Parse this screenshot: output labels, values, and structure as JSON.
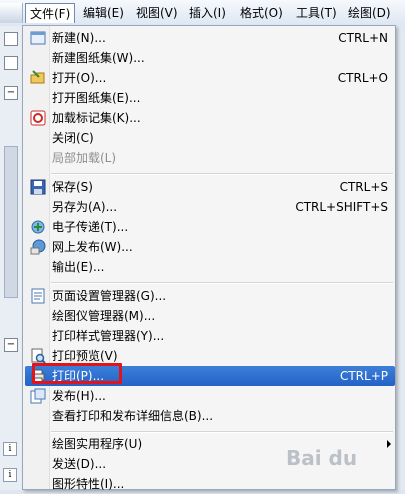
{
  "menubar": {
    "items": [
      "文件(F)",
      "编辑(E)",
      "视图(V)",
      "插入(I)",
      "格式(O)",
      "工具(T)",
      "绘图(D)"
    ],
    "active_index": 0
  },
  "file_menu": {
    "items": [
      {
        "label": "新建(N)...",
        "shortcut": "CTRL+N",
        "icon": "new-document-icon"
      },
      {
        "label": "新建图纸集(W)...",
        "shortcut": "",
        "icon": ""
      },
      {
        "label": "打开(O)...",
        "shortcut": "CTRL+O",
        "icon": "open-folder-icon"
      },
      {
        "label": "打开图纸集(E)...",
        "shortcut": "",
        "icon": ""
      },
      {
        "label": "加载标记集(K)...",
        "shortcut": "",
        "icon": "markup-icon"
      },
      {
        "label": "关闭(C)",
        "shortcut": "",
        "icon": ""
      },
      {
        "label": "局部加载(L)",
        "shortcut": "",
        "icon": "",
        "disabled": true
      },
      {
        "label": "保存(S)",
        "shortcut": "CTRL+S",
        "icon": "save-icon"
      },
      {
        "label": "另存为(A)...",
        "shortcut": "CTRL+SHIFT+S",
        "icon": ""
      },
      {
        "label": "电子传递(T)...",
        "shortcut": "",
        "icon": "etransmit-icon"
      },
      {
        "label": "网上发布(W)...",
        "shortcut": "",
        "icon": "publish-web-icon"
      },
      {
        "label": "输出(E)...",
        "shortcut": "",
        "icon": ""
      },
      {
        "label": "页面设置管理器(G)...",
        "shortcut": "",
        "icon": "page-setup-icon"
      },
      {
        "label": "绘图仪管理器(M)...",
        "shortcut": "",
        "icon": ""
      },
      {
        "label": "打印样式管理器(Y)...",
        "shortcut": "",
        "icon": ""
      },
      {
        "label": "打印预览(V)",
        "shortcut": "",
        "icon": "print-preview-icon"
      },
      {
        "label": "打印(P)...",
        "shortcut": "CTRL+P",
        "icon": "print-icon",
        "highlighted": true
      },
      {
        "label": "发布(H)...",
        "shortcut": "",
        "icon": "publish-icon"
      },
      {
        "label": "查看打印和发布详细信息(B)...",
        "shortcut": "",
        "icon": ""
      },
      {
        "label": "绘图实用程序(U)",
        "shortcut": "",
        "icon": "",
        "submenu": true
      },
      {
        "label": "发送(D)...",
        "shortcut": "",
        "icon": ""
      },
      {
        "label": "图形特性(I)...",
        "shortcut": "",
        "icon": ""
      }
    ]
  },
  "watermark": {
    "text": "Bai du"
  },
  "colors": {
    "highlight": "#2a6cd0",
    "annotation": "#e0141a"
  }
}
